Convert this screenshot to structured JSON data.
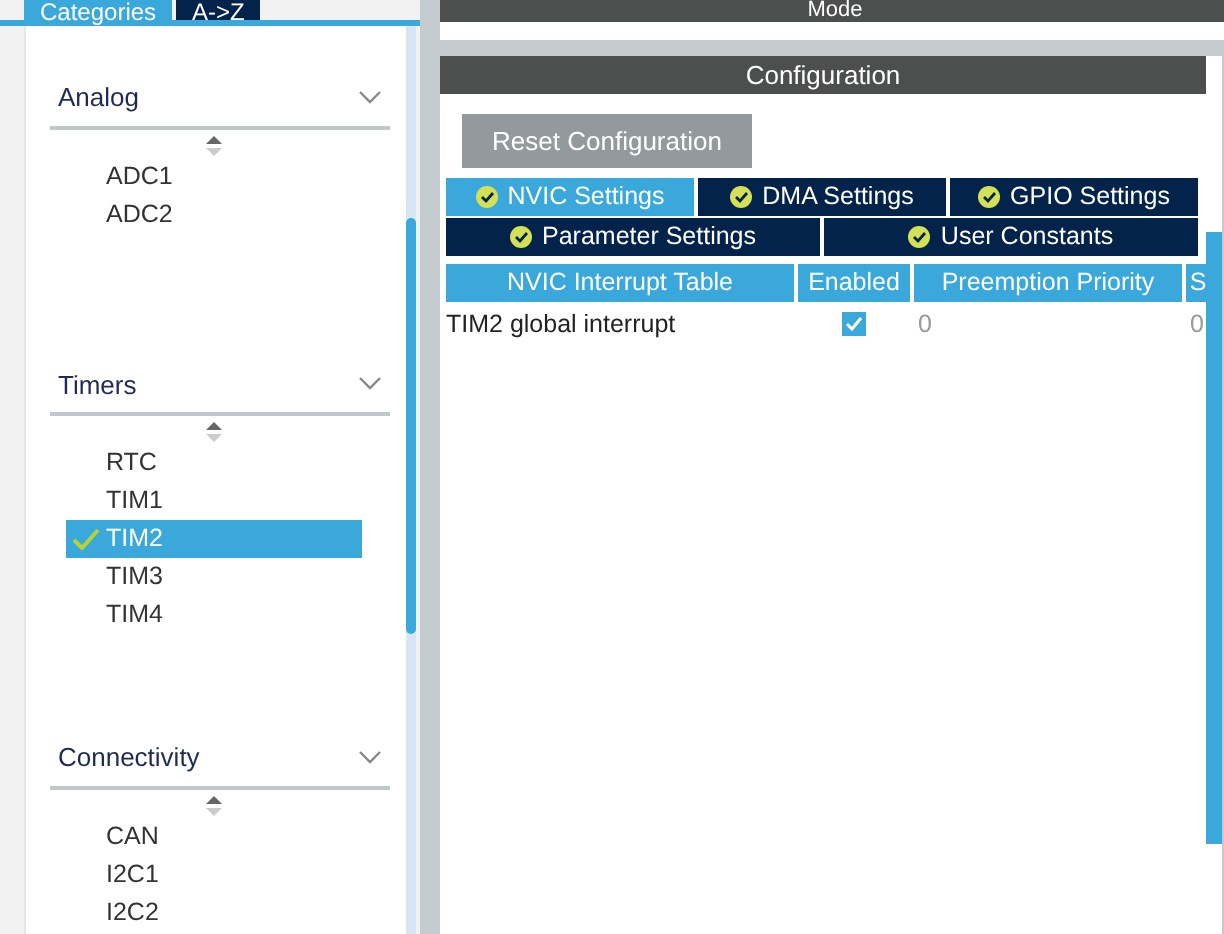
{
  "sidebar": {
    "tabs": [
      {
        "label": "Categories",
        "selected": true
      },
      {
        "label": "A->Z",
        "selected": false
      }
    ],
    "categories": [
      {
        "title": "Analog",
        "items": [
          {
            "label": "ADC1",
            "selected": false,
            "configured": false
          },
          {
            "label": "ADC2",
            "selected": false,
            "configured": false
          }
        ]
      },
      {
        "title": "Timers",
        "items": [
          {
            "label": "RTC",
            "selected": false,
            "configured": false
          },
          {
            "label": "TIM1",
            "selected": false,
            "configured": false
          },
          {
            "label": "TIM2",
            "selected": true,
            "configured": true
          },
          {
            "label": "TIM3",
            "selected": false,
            "configured": false
          },
          {
            "label": "TIM4",
            "selected": false,
            "configured": false
          }
        ]
      },
      {
        "title": "Connectivity",
        "items": [
          {
            "label": "CAN",
            "selected": false,
            "configured": false
          },
          {
            "label": "I2C1",
            "selected": false,
            "configured": false
          },
          {
            "label": "I2C2",
            "selected": false,
            "configured": false
          }
        ]
      }
    ]
  },
  "mode": {
    "title": "Mode"
  },
  "configuration": {
    "title": "Configuration",
    "reset_button": "Reset Configuration",
    "tab_rows": [
      [
        {
          "label": "NVIC Settings",
          "selected": true
        },
        {
          "label": "DMA Settings",
          "selected": false
        },
        {
          "label": "GPIO Settings",
          "selected": false
        }
      ],
      [
        {
          "label": "Parameter Settings",
          "selected": false
        },
        {
          "label": "User Constants",
          "selected": false
        }
      ]
    ],
    "table": {
      "columns": [
        "NVIC Interrupt Table",
        "Enabled",
        "Preemption Priority",
        "S"
      ],
      "rows": [
        {
          "name": "TIM2 global interrupt",
          "enabled": true,
          "preemption_priority": "0",
          "column_4": "0"
        }
      ]
    }
  }
}
